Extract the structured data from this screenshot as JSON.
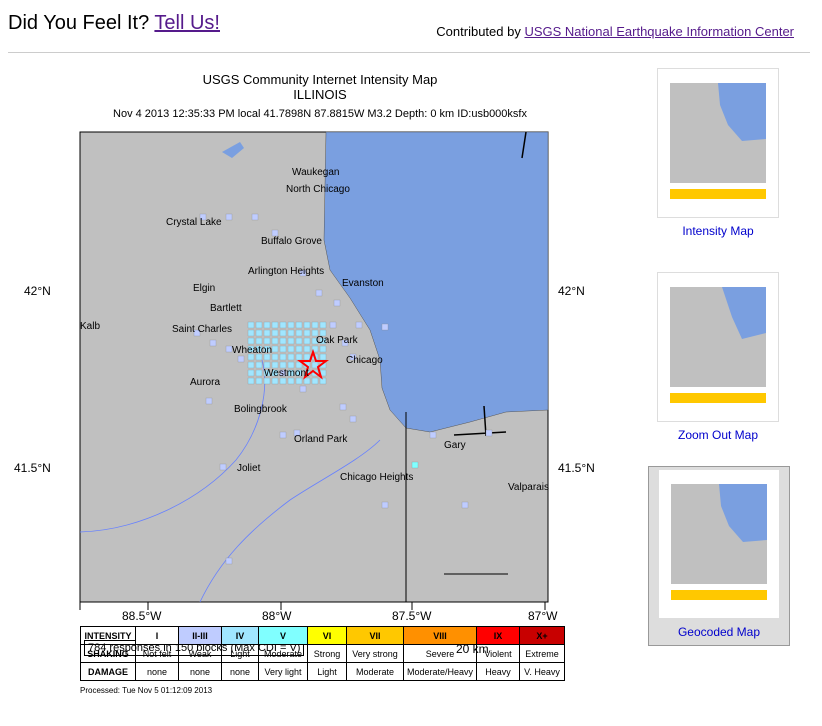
{
  "header": {
    "title_prefix": "Did You Feel It?",
    "title_link": "Tell Us!",
    "contrib_prefix": "Contributed by",
    "contrib_link": "USGS National Earthquake Information Center"
  },
  "map": {
    "title_line1": "USGS Community Internet Intensity Map",
    "title_line2": "ILLINOIS",
    "info": "Nov 4 2013 12:35:33 PM local 41.7898N 87.8815W M3.2 Depth: 0 km ID:usb000ksfx",
    "lat_labels": [
      "42°N",
      "42°N",
      "41.5°N",
      "41.5°N"
    ],
    "lon_labels": [
      "88.5°W",
      "88°W",
      "87.5°W",
      "87°W"
    ],
    "responses": "784 responses in 150 blocks (Max CDI = V)",
    "scale": "20 km",
    "processed": "Processed: Tue Nov  5 01:12:09 2013",
    "cities": [
      "Waukegan",
      "North Chicago",
      "Crystal Lake",
      "Buffalo Grove",
      "Arlington Heights",
      "Evanston",
      "Elgin",
      "Bartlett",
      "Kalb",
      "Saint Charles",
      "Oak Park",
      "Wheaton",
      "Chicago",
      "Westmont",
      "Aurora",
      "Bolingbrook",
      "Orland Park",
      "Gary",
      "Joliet",
      "Chicago Heights",
      "Valparais"
    ],
    "colors": {
      "land": "#c0c0c0",
      "water": "#7a9fe0",
      "cdi2": "#bfccff",
      "cdi3": "#a0e6ff",
      "cdi4": "#80ffff",
      "epicenter": "#ff0000"
    }
  },
  "legend": {
    "headers": [
      "INTENSITY",
      "SHAKING",
      "DAMAGE"
    ],
    "intensity": [
      "I",
      "II-III",
      "IV",
      "V",
      "VI",
      "VII",
      "VIII",
      "IX",
      "X+"
    ],
    "shaking": [
      "Not felt",
      "Weak",
      "Light",
      "Moderate",
      "Strong",
      "Very strong",
      "Severe",
      "Violent",
      "Extreme"
    ],
    "damage": [
      "none",
      "none",
      "none",
      "Very light",
      "Light",
      "Moderate",
      "Moderate/Heavy",
      "Heavy",
      "V. Heavy"
    ],
    "colors": [
      "#ffffff",
      "#bfccff",
      "#a0e6ff",
      "#80ffff",
      "#ffff00",
      "#ffc800",
      "#ff9000",
      "#ff0000",
      "#c80000"
    ]
  },
  "thumbnails": [
    {
      "label": "Intensity Map",
      "selected": false
    },
    {
      "label": "Zoom Out Map",
      "selected": false
    },
    {
      "label": "Geocoded Map",
      "selected": true
    }
  ]
}
